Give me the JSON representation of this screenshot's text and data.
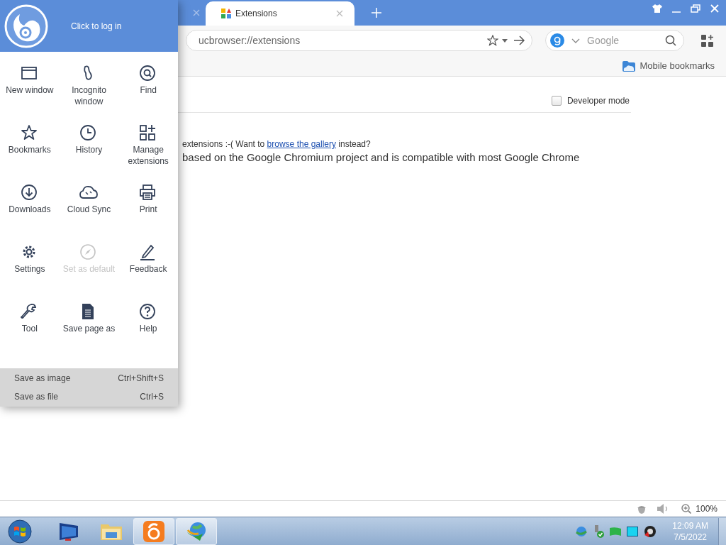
{
  "tabs": [
    {
      "selected": false
    },
    {
      "label": "Extensions",
      "selected": true
    }
  ],
  "address": {
    "value": "ucbrowser://extensions"
  },
  "search": {
    "placeholder": "Google"
  },
  "bookmarks_bar": {
    "label": "Mobile bookmarks"
  },
  "developer_mode": {
    "label": "Developer mode",
    "checked": false
  },
  "content": {
    "message_before": "extensions :-( Want to ",
    "message_link": "browse the gallery",
    "message_after": " instead?",
    "description": "based on the Google Chromium project and is compatible with most Google Chrome"
  },
  "status_bar": {
    "zoom": "100%"
  },
  "menu": {
    "login": "Click to log in",
    "items": [
      {
        "label": "New window",
        "disabled": false
      },
      {
        "label": "Incognito window",
        "disabled": false
      },
      {
        "label": "Find",
        "disabled": false
      },
      {
        "label": "Bookmarks",
        "disabled": false
      },
      {
        "label": "History",
        "disabled": false
      },
      {
        "label": "Manage extensions",
        "disabled": false
      },
      {
        "label": "Downloads",
        "disabled": false
      },
      {
        "label": "Cloud Sync",
        "disabled": false
      },
      {
        "label": "Print",
        "disabled": false
      },
      {
        "label": "Settings",
        "disabled": false
      },
      {
        "label": "Set as default",
        "disabled": true
      },
      {
        "label": "Feedback",
        "disabled": false
      },
      {
        "label": "Tool",
        "disabled": false
      },
      {
        "label": "Save page as",
        "disabled": false
      },
      {
        "label": "Help",
        "disabled": false
      }
    ],
    "submenu": [
      {
        "label": "Save as image",
        "shortcut": "Ctrl+Shift+S"
      },
      {
        "label": "Save as file",
        "shortcut": "Ctrl+S"
      }
    ]
  },
  "taskbar": {
    "apps": [
      {
        "active": false
      },
      {
        "active": false
      },
      {
        "active": true
      },
      {
        "active": true
      }
    ],
    "time": "12:09 AM",
    "date": "7/5/2022"
  }
}
